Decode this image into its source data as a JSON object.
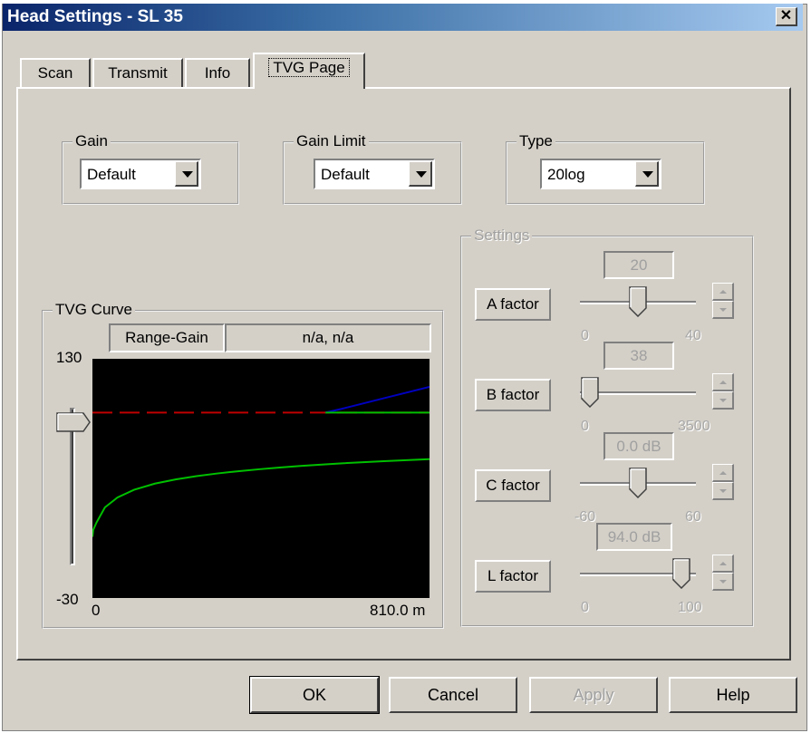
{
  "window": {
    "title": "Head Settings - SL 35",
    "close_label": "✕"
  },
  "tabs": [
    {
      "label": "Scan"
    },
    {
      "label": "Transmit"
    },
    {
      "label": "Info"
    },
    {
      "label": "TVG Page",
      "active": true
    }
  ],
  "gain": {
    "label": "Gain",
    "value": "Default"
  },
  "gain_limit": {
    "label": "Gain Limit",
    "value": "Default"
  },
  "type": {
    "label": "Type",
    "value": "20log"
  },
  "settings": {
    "label": "Settings",
    "factors": [
      {
        "label": "A factor",
        "value": "20",
        "min": "0",
        "max": "40",
        "level": 0.5
      },
      {
        "label": "B factor",
        "value": "38",
        "min": "0",
        "max": "3500",
        "level": 0.011
      },
      {
        "label": "C factor",
        "value": "0.0 dB",
        "min": "-60",
        "max": "60",
        "level": 0.5
      },
      {
        "label": "L factor",
        "value": "94.0 dB",
        "min": "0",
        "max": "100",
        "level": 0.94
      }
    ]
  },
  "tvg_curve": {
    "label": "TVG Curve",
    "readout_label": "Range-Gain",
    "readout_value": "n/a, n/a",
    "y_max_label": "130",
    "y_min_label": "-30",
    "x_min_label": "0",
    "x_max_label": "810.0 m",
    "gain_slider_level": 0.93
  },
  "buttons": {
    "ok": "OK",
    "cancel": "Cancel",
    "apply": "Apply",
    "help": "Help"
  },
  "colors": {
    "titlebar": "#0a246a",
    "curve": "#00c000",
    "limit_line": "#c00000",
    "overflow_line": "#0000c0",
    "plot_bg": "#000000"
  },
  "chart_data": {
    "type": "line",
    "xlabel": "",
    "ylabel": "",
    "xlim": [
      0,
      810
    ],
    "ylim": [
      -30,
      130
    ],
    "series": [
      {
        "x": [
          0,
          2,
          10,
          30,
          60,
          100,
          150,
          200,
          250,
          300,
          350,
          400,
          450,
          500,
          560,
          600,
          700,
          810
        ],
        "y": [
          10.9,
          15.6,
          20.6,
          30.6,
          37.2,
          42.4,
          46.5,
          49.3,
          51.5,
          53.3,
          54.8,
          56.1,
          57.3,
          58.3,
          59.4,
          60.1,
          61.5,
          62.9
        ]
      },
      {
        "x": [
          0,
          810
        ],
        "y": [
          94,
          94
        ]
      },
      {
        "x": [
          560,
          600,
          700,
          810
        ],
        "y": [
          94.0,
          96.6,
          103.6,
          111.2
        ]
      }
    ]
  }
}
